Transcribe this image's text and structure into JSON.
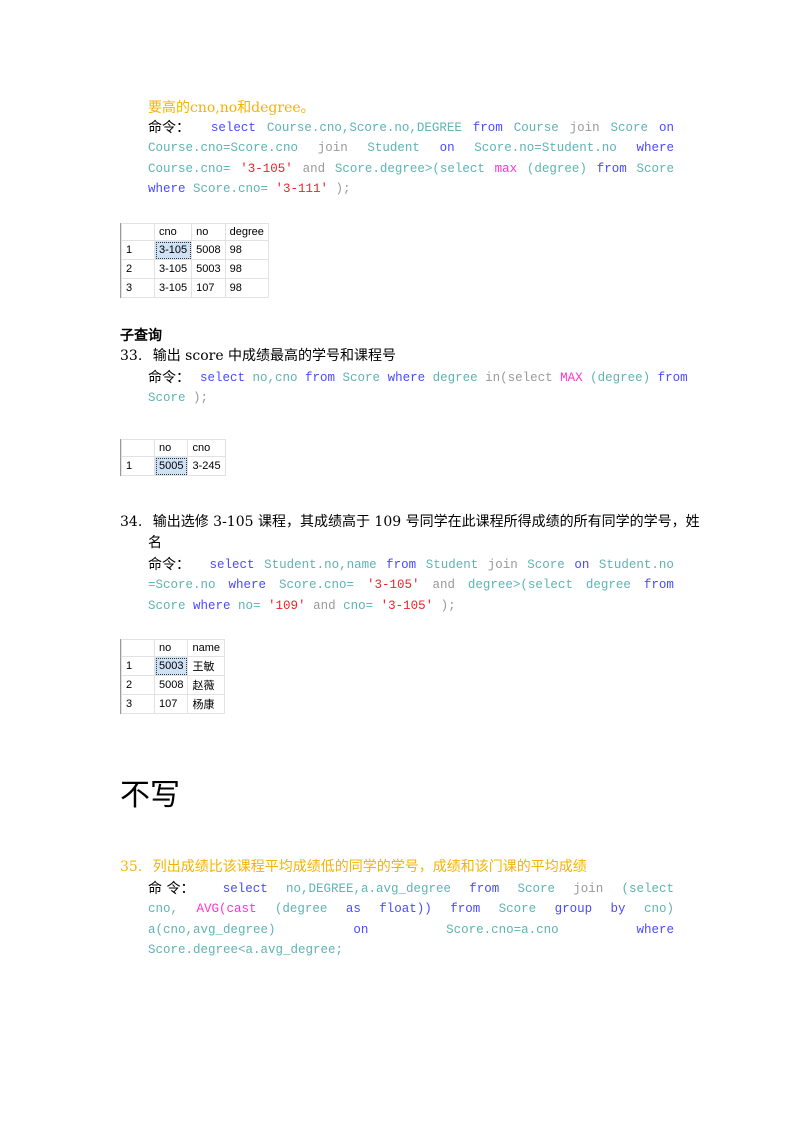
{
  "section1": {
    "heading": "要高的cno,no和degree。",
    "command_label": "命令：",
    "sql_lines": [
      [
        [
          "kw",
          "select"
        ],
        [
          "id",
          "Course.cno,Score.no,DEGREE"
        ],
        [
          "kw",
          "from"
        ],
        [
          "id",
          "Course"
        ],
        [
          "op",
          "join"
        ],
        [
          "id",
          "Score"
        ],
        [
          "kw",
          "on"
        ]
      ],
      [
        [
          "id",
          "Course.cno=Score.cno"
        ],
        [
          "op",
          "join"
        ],
        [
          "id",
          "Student"
        ],
        [
          "kw",
          "on"
        ],
        [
          "id",
          "Score.no=Student.no"
        ],
        [
          "kw",
          "where"
        ]
      ],
      [
        [
          "id",
          "Course.cno="
        ],
        [
          "str",
          "'3-105'"
        ],
        [
          "op",
          "and"
        ],
        [
          "id",
          "Score.degree>(select"
        ],
        [
          "fn",
          "max"
        ],
        [
          "id",
          "(degree)"
        ],
        [
          "kw",
          "from"
        ],
        [
          "id",
          "Score"
        ]
      ],
      [
        [
          "kw",
          "where"
        ],
        [
          "id",
          "Score.cno="
        ],
        [
          "str",
          "'3-111'"
        ],
        [
          "op",
          ");"
        ]
      ]
    ],
    "result": {
      "columns": [
        "",
        "cno",
        "no",
        "degree"
      ],
      "rows": [
        [
          "1",
          "3-105",
          "5008",
          "98"
        ],
        [
          "2",
          "3-105",
          "5003",
          "98"
        ],
        [
          "3",
          "3-105",
          "107",
          "98"
        ]
      ]
    }
  },
  "subquery_heading": "子查询",
  "q33": {
    "number": "33.",
    "title": "输出 score 中成绩最高的学号和课程号",
    "command_label": "命令：",
    "sql_lines": [
      [
        [
          "kw",
          "select"
        ],
        [
          "id",
          "no,cno"
        ],
        [
          "kw",
          "from"
        ],
        [
          "id",
          "Score"
        ],
        [
          "kw",
          "where"
        ],
        [
          "id",
          "degree"
        ],
        [
          "op",
          "in(select"
        ],
        [
          "fn",
          "MAX"
        ],
        [
          "id",
          "(degree)"
        ],
        [
          "kw",
          "from"
        ]
      ],
      [
        [
          "id",
          "Score"
        ],
        [
          "op",
          ");"
        ]
      ]
    ],
    "result": {
      "columns": [
        "",
        "no",
        "cno"
      ],
      "rows": [
        [
          "1",
          "5005",
          "3-245"
        ]
      ]
    }
  },
  "q34": {
    "number": "34.",
    "title_line1": "输出选修 3-105 课程，其成绩高于 109 号同学在此课程所得成绩的所有同学的学号，姓",
    "title_line2": "名",
    "command_label": "命令：",
    "sql_lines": [
      [
        [
          "kw",
          "select"
        ],
        [
          "id",
          "Student.no,name"
        ],
        [
          "kw",
          "from"
        ],
        [
          "id",
          "Student"
        ],
        [
          "op",
          "join"
        ],
        [
          "id",
          "Score"
        ],
        [
          "kw",
          "on"
        ],
        [
          "id",
          "Student.no"
        ]
      ],
      [
        [
          "id",
          "=Score.no"
        ],
        [
          "kw",
          "where"
        ],
        [
          "id",
          "Score.cno="
        ],
        [
          "str",
          "'3-105'"
        ],
        [
          "op",
          "and"
        ],
        [
          "id",
          "degree>(select"
        ],
        [
          "id",
          "degree"
        ],
        [
          "kw",
          "from"
        ]
      ],
      [
        [
          "id",
          "Score"
        ],
        [
          "kw",
          "where"
        ],
        [
          "id",
          "no="
        ],
        [
          "str",
          "'109'"
        ],
        [
          "op",
          "and"
        ],
        [
          "id",
          "cno="
        ],
        [
          "str",
          "'3-105'"
        ],
        [
          "op",
          ");"
        ]
      ]
    ],
    "result": {
      "columns": [
        "",
        "no",
        "name"
      ],
      "rows": [
        [
          "1",
          "5003",
          "王敏"
        ],
        [
          "2",
          "5008",
          "赵薇"
        ],
        [
          "3",
          "107",
          "杨康"
        ]
      ]
    }
  },
  "note_big": "不写",
  "q35": {
    "number": "35.",
    "title": "列出成绩比该课程平均成绩低的同学的学号，成绩和该门课的平均成绩",
    "command_label": "命 令：",
    "sql_lines": [
      [
        [
          "kw",
          "select"
        ],
        [
          "id",
          "no,DEGREE,a.avg_degree"
        ],
        [
          "kw",
          "from"
        ],
        [
          "id",
          "Score"
        ],
        [
          "op",
          "join"
        ],
        [
          "id",
          "(select"
        ]
      ],
      [
        [
          "id",
          "cno,"
        ],
        [
          "fn",
          "AVG(cast"
        ],
        [
          "id",
          "(degree"
        ],
        [
          "kw",
          "as"
        ],
        [
          "kw",
          "float))"
        ],
        [
          "kw",
          "from"
        ],
        [
          "id",
          "Score"
        ],
        [
          "kw",
          "group"
        ],
        [
          "kw",
          "by"
        ],
        [
          "id",
          "cno)"
        ]
      ],
      [
        [
          "id",
          "a(cno,avg_degree)"
        ],
        [
          "kw",
          "on"
        ],
        [
          "id",
          "Score.cno=a.cno"
        ],
        [
          "kw",
          "where"
        ]
      ],
      [
        [
          "id",
          "Score.degree<a.avg_degree;"
        ]
      ]
    ]
  }
}
